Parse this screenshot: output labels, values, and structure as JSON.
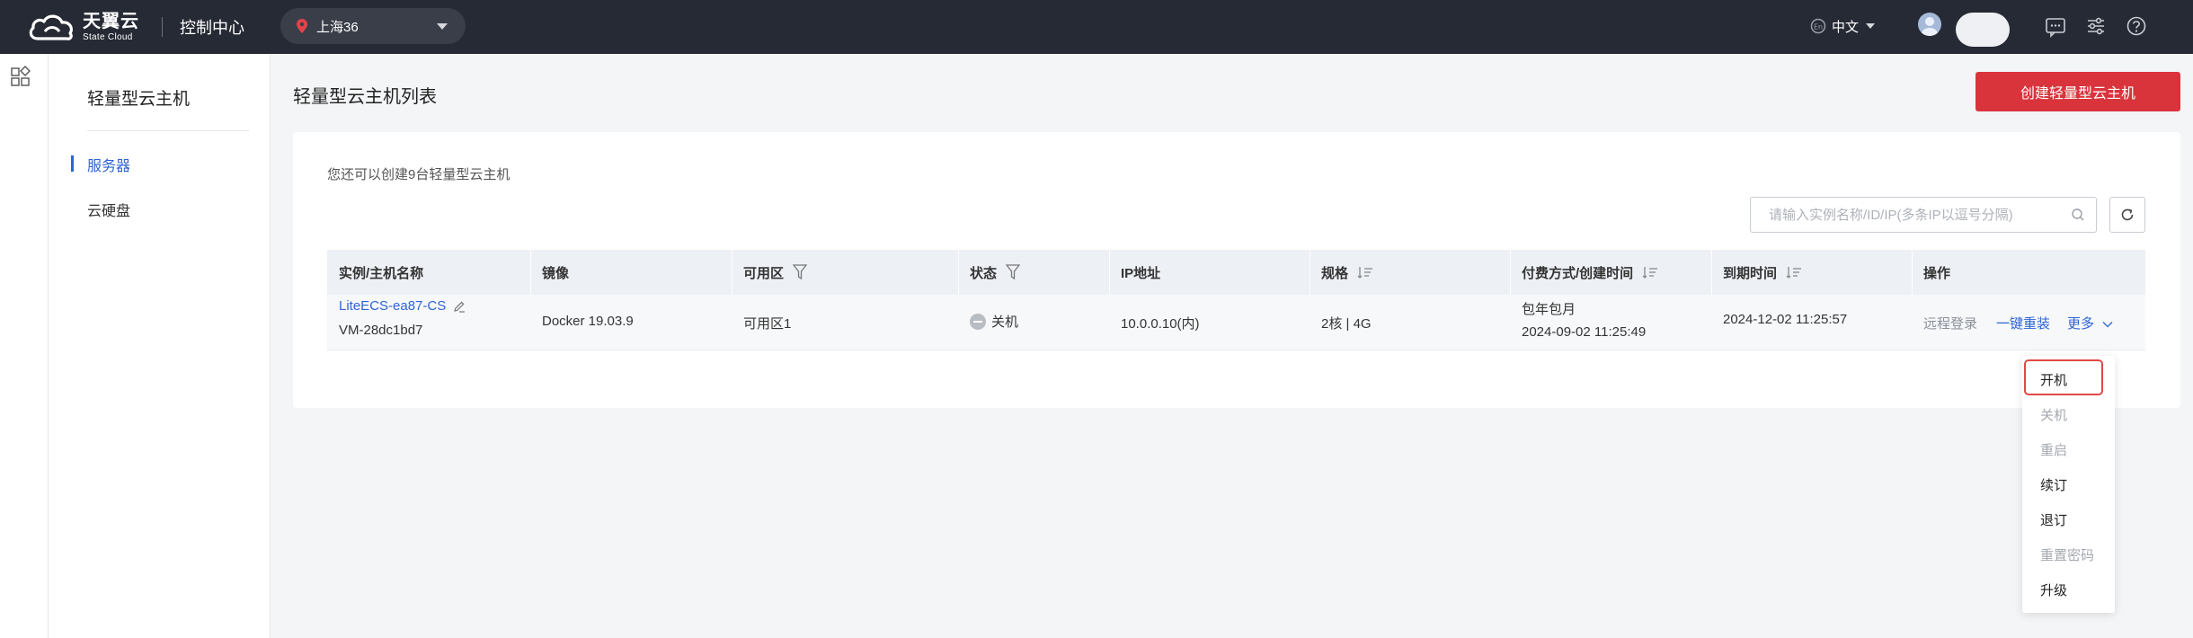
{
  "header": {
    "logo_cn": "天翼云",
    "logo_en": "State Cloud",
    "console_title": "控制中心",
    "region": "上海36",
    "language": "中文"
  },
  "sidebar": {
    "title": "轻量型云主机",
    "items": [
      {
        "label": "服务器",
        "active": true
      },
      {
        "label": "云硬盘",
        "active": false
      }
    ]
  },
  "main": {
    "title": "轻量型云主机列表",
    "create_button": "创建轻量型云主机",
    "quota_text": "您还可以创建9台轻量型云主机",
    "search_placeholder": "请输入实例名称/ID/IP(多条IP以逗号分隔)"
  },
  "table": {
    "columns": [
      "实例/主机名称",
      "镜像",
      "可用区",
      "状态",
      "IP地址",
      "规格",
      "付费方式/创建时间",
      "到期时间",
      "操作"
    ],
    "rows": [
      {
        "instance_name": "LiteECS-ea87-CS",
        "host_name": "VM-28dc1bd7",
        "image": "Docker 19.03.9",
        "zone": "可用区1",
        "status": "关机",
        "ip": "10.0.0.10(内)",
        "spec": "2核 | 4G",
        "billing": "包年包月",
        "created": "2024-09-02 11:25:49",
        "expires": "2024-12-02 11:25:57",
        "actions": {
          "remote_login": "远程登录",
          "reinstall": "一键重装",
          "more": "更多"
        }
      }
    ]
  },
  "more_menu": {
    "items": [
      {
        "label": "开机",
        "enabled": true,
        "highlighted": true
      },
      {
        "label": "关机",
        "enabled": false
      },
      {
        "label": "重启",
        "enabled": false
      },
      {
        "label": "续订",
        "enabled": true
      },
      {
        "label": "退订",
        "enabled": true
      },
      {
        "label": "重置密码",
        "enabled": false
      },
      {
        "label": "升级",
        "enabled": true
      }
    ]
  },
  "colors": {
    "topbar": "#262a34",
    "accent_blue": "#2e64d6",
    "create_red": "#d9343c",
    "highlight_red": "#e04848"
  }
}
